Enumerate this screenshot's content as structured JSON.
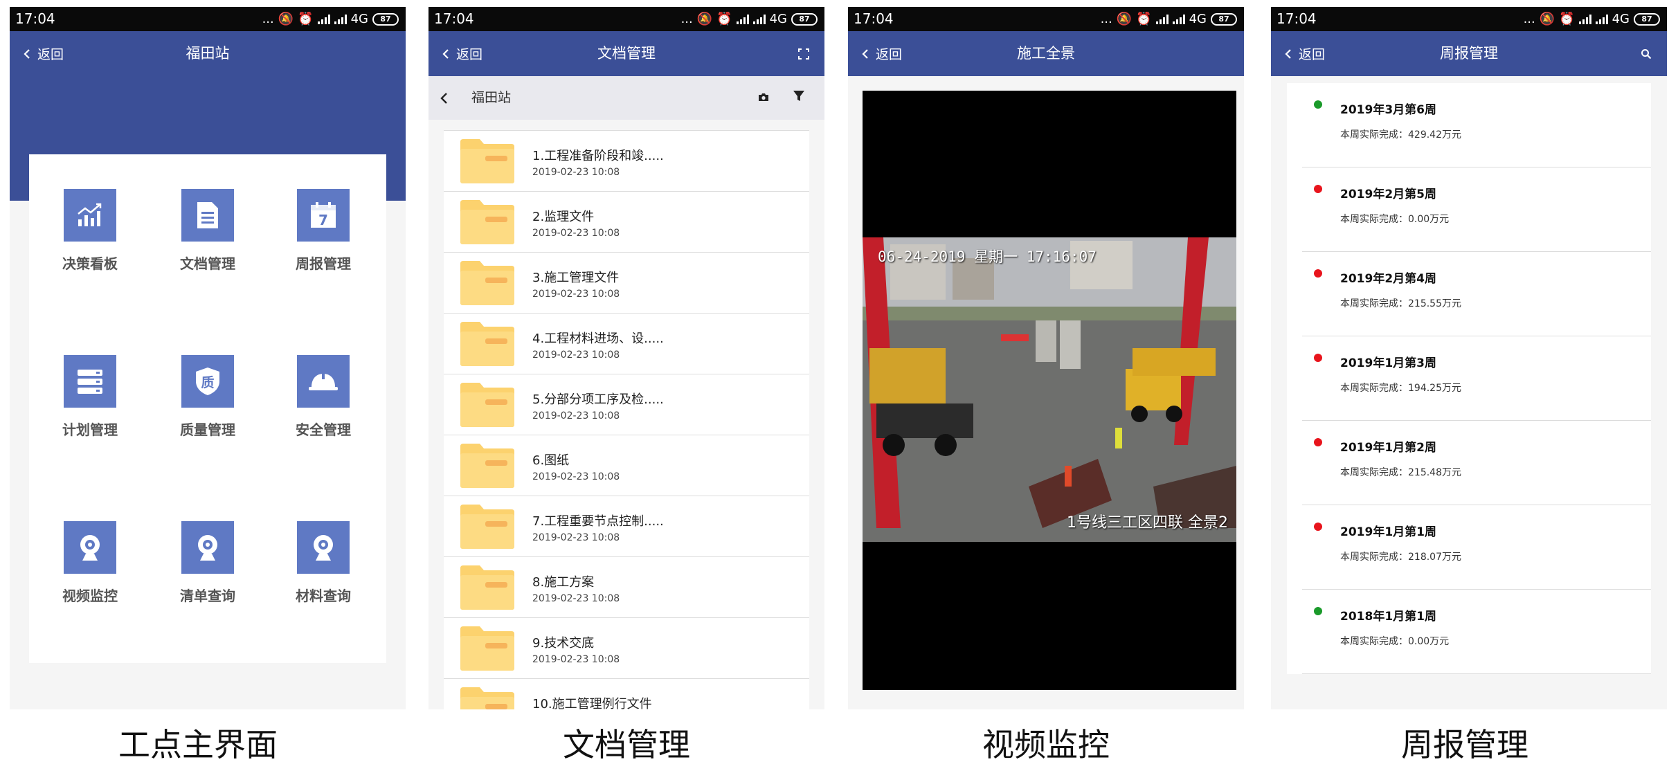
{
  "status": {
    "time": "17:04",
    "dots": "...",
    "network": "4G",
    "battery": "87"
  },
  "icons": {
    "back": "chevron-left-icon",
    "fullscreen": "fullscreen-icon",
    "search": "search-icon",
    "camera": "camera-icon",
    "filter": "filter-icon",
    "folder": "folder-icon"
  },
  "colors": {
    "nav": "#3b4f97",
    "tile": "#5f79c4",
    "folder": "#fcd26e",
    "green": "#1a9a2a",
    "red": "#e8141c"
  },
  "screen1": {
    "back_label": "返回",
    "title": "福田站",
    "tiles": [
      {
        "label": "决策看板",
        "icon": "chart-icon"
      },
      {
        "label": "文档管理",
        "icon": "document-icon"
      },
      {
        "label": "周报管理",
        "icon": "calendar-icon",
        "icon_text": "7"
      },
      {
        "label": "计划管理",
        "icon": "plan-icon"
      },
      {
        "label": "质量管理",
        "icon": "quality-shield-icon",
        "icon_text": "质"
      },
      {
        "label": "安全管理",
        "icon": "helmet-icon"
      },
      {
        "label": "视频监控",
        "icon": "webcam-icon"
      },
      {
        "label": "清单查询",
        "icon": "webcam-icon"
      },
      {
        "label": "材料查询",
        "icon": "webcam-icon"
      }
    ],
    "caption": "工点主界面"
  },
  "screen2": {
    "back_label": "返回",
    "title": "文档管理",
    "folder_name": "福田站",
    "docs": [
      {
        "name": "1.工程准备阶段和竣.....",
        "date": "2019-02-23 10:08"
      },
      {
        "name": "2.监理文件",
        "date": "2019-02-23 10:08"
      },
      {
        "name": "3.施工管理文件",
        "date": "2019-02-23 10:08"
      },
      {
        "name": "4.工程材料进场、设.....",
        "date": "2019-02-23 10:08"
      },
      {
        "name": "5.分部分项工序及检.....",
        "date": "2019-02-23 10:08"
      },
      {
        "name": "6.图纸",
        "date": "2019-02-23 10:08"
      },
      {
        "name": "7.工程重要节点控制.....",
        "date": "2019-02-23 10:08"
      },
      {
        "name": "8.施工方案",
        "date": "2019-02-23 10:08"
      },
      {
        "name": "9.技术交底",
        "date": "2019-02-23 10:08"
      },
      {
        "name": "10.施工管理例行文件",
        "date": ""
      }
    ],
    "caption": "文档管理"
  },
  "screen3": {
    "back_label": "返回",
    "title": "施工全景",
    "osd_top": "06-24-2019 星期一 17:16:07",
    "osd_bottom": "1号线三工区四联      全景2",
    "caption": "视频监控"
  },
  "screen4": {
    "back_label": "返回",
    "title": "周报管理",
    "weeks": [
      {
        "title": "2019年3月第6周",
        "sub": "本周实际完成：429.42万元",
        "status": "green"
      },
      {
        "title": "2019年2月第5周",
        "sub": "本周实际完成：0.00万元",
        "status": "red"
      },
      {
        "title": "2019年2月第4周",
        "sub": "本周实际完成：215.55万元",
        "status": "red"
      },
      {
        "title": "2019年1月第3周",
        "sub": "本周实际完成：194.25万元",
        "status": "red"
      },
      {
        "title": "2019年1月第2周",
        "sub": "本周实际完成：215.48万元",
        "status": "red"
      },
      {
        "title": "2019年1月第1周",
        "sub": "本周实际完成：218.07万元",
        "status": "red"
      },
      {
        "title": "2018年1月第1周",
        "sub": "本周实际完成：0.00万元",
        "status": "green"
      }
    ],
    "caption": "周报管理"
  }
}
